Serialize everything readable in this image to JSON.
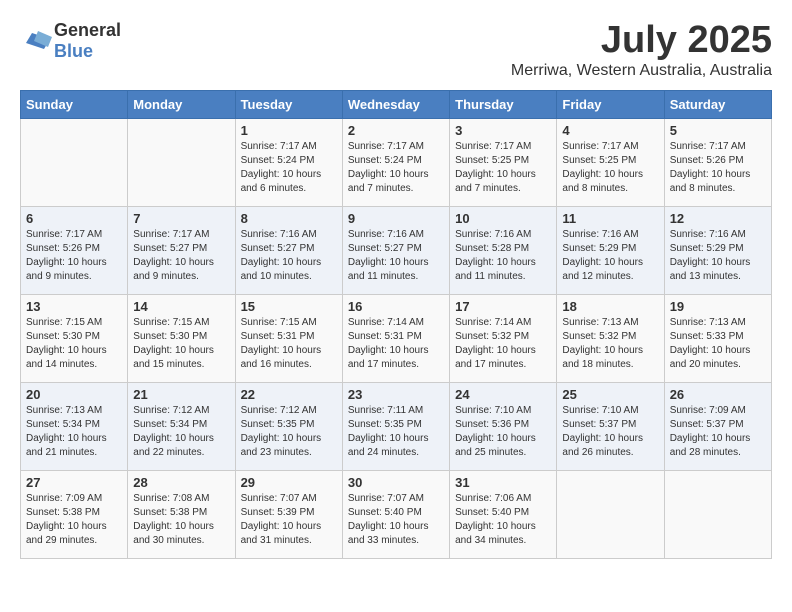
{
  "header": {
    "logo_general": "General",
    "logo_blue": "Blue",
    "month_year": "July 2025",
    "location": "Merriwa, Western Australia, Australia"
  },
  "weekdays": [
    "Sunday",
    "Monday",
    "Tuesday",
    "Wednesday",
    "Thursday",
    "Friday",
    "Saturday"
  ],
  "weeks": [
    [
      {
        "day": "",
        "sunrise": "",
        "sunset": "",
        "daylight": ""
      },
      {
        "day": "",
        "sunrise": "",
        "sunset": "",
        "daylight": ""
      },
      {
        "day": "1",
        "sunrise": "Sunrise: 7:17 AM",
        "sunset": "Sunset: 5:24 PM",
        "daylight": "Daylight: 10 hours and 6 minutes."
      },
      {
        "day": "2",
        "sunrise": "Sunrise: 7:17 AM",
        "sunset": "Sunset: 5:24 PM",
        "daylight": "Daylight: 10 hours and 7 minutes."
      },
      {
        "day": "3",
        "sunrise": "Sunrise: 7:17 AM",
        "sunset": "Sunset: 5:25 PM",
        "daylight": "Daylight: 10 hours and 7 minutes."
      },
      {
        "day": "4",
        "sunrise": "Sunrise: 7:17 AM",
        "sunset": "Sunset: 5:25 PM",
        "daylight": "Daylight: 10 hours and 8 minutes."
      },
      {
        "day": "5",
        "sunrise": "Sunrise: 7:17 AM",
        "sunset": "Sunset: 5:26 PM",
        "daylight": "Daylight: 10 hours and 8 minutes."
      }
    ],
    [
      {
        "day": "6",
        "sunrise": "Sunrise: 7:17 AM",
        "sunset": "Sunset: 5:26 PM",
        "daylight": "Daylight: 10 hours and 9 minutes."
      },
      {
        "day": "7",
        "sunrise": "Sunrise: 7:17 AM",
        "sunset": "Sunset: 5:27 PM",
        "daylight": "Daylight: 10 hours and 9 minutes."
      },
      {
        "day": "8",
        "sunrise": "Sunrise: 7:16 AM",
        "sunset": "Sunset: 5:27 PM",
        "daylight": "Daylight: 10 hours and 10 minutes."
      },
      {
        "day": "9",
        "sunrise": "Sunrise: 7:16 AM",
        "sunset": "Sunset: 5:27 PM",
        "daylight": "Daylight: 10 hours and 11 minutes."
      },
      {
        "day": "10",
        "sunrise": "Sunrise: 7:16 AM",
        "sunset": "Sunset: 5:28 PM",
        "daylight": "Daylight: 10 hours and 11 minutes."
      },
      {
        "day": "11",
        "sunrise": "Sunrise: 7:16 AM",
        "sunset": "Sunset: 5:29 PM",
        "daylight": "Daylight: 10 hours and 12 minutes."
      },
      {
        "day": "12",
        "sunrise": "Sunrise: 7:16 AM",
        "sunset": "Sunset: 5:29 PM",
        "daylight": "Daylight: 10 hours and 13 minutes."
      }
    ],
    [
      {
        "day": "13",
        "sunrise": "Sunrise: 7:15 AM",
        "sunset": "Sunset: 5:30 PM",
        "daylight": "Daylight: 10 hours and 14 minutes."
      },
      {
        "day": "14",
        "sunrise": "Sunrise: 7:15 AM",
        "sunset": "Sunset: 5:30 PM",
        "daylight": "Daylight: 10 hours and 15 minutes."
      },
      {
        "day": "15",
        "sunrise": "Sunrise: 7:15 AM",
        "sunset": "Sunset: 5:31 PM",
        "daylight": "Daylight: 10 hours and 16 minutes."
      },
      {
        "day": "16",
        "sunrise": "Sunrise: 7:14 AM",
        "sunset": "Sunset: 5:31 PM",
        "daylight": "Daylight: 10 hours and 17 minutes."
      },
      {
        "day": "17",
        "sunrise": "Sunrise: 7:14 AM",
        "sunset": "Sunset: 5:32 PM",
        "daylight": "Daylight: 10 hours and 17 minutes."
      },
      {
        "day": "18",
        "sunrise": "Sunrise: 7:13 AM",
        "sunset": "Sunset: 5:32 PM",
        "daylight": "Daylight: 10 hours and 18 minutes."
      },
      {
        "day": "19",
        "sunrise": "Sunrise: 7:13 AM",
        "sunset": "Sunset: 5:33 PM",
        "daylight": "Daylight: 10 hours and 20 minutes."
      }
    ],
    [
      {
        "day": "20",
        "sunrise": "Sunrise: 7:13 AM",
        "sunset": "Sunset: 5:34 PM",
        "daylight": "Daylight: 10 hours and 21 minutes."
      },
      {
        "day": "21",
        "sunrise": "Sunrise: 7:12 AM",
        "sunset": "Sunset: 5:34 PM",
        "daylight": "Daylight: 10 hours and 22 minutes."
      },
      {
        "day": "22",
        "sunrise": "Sunrise: 7:12 AM",
        "sunset": "Sunset: 5:35 PM",
        "daylight": "Daylight: 10 hours and 23 minutes."
      },
      {
        "day": "23",
        "sunrise": "Sunrise: 7:11 AM",
        "sunset": "Sunset: 5:35 PM",
        "daylight": "Daylight: 10 hours and 24 minutes."
      },
      {
        "day": "24",
        "sunrise": "Sunrise: 7:10 AM",
        "sunset": "Sunset: 5:36 PM",
        "daylight": "Daylight: 10 hours and 25 minutes."
      },
      {
        "day": "25",
        "sunrise": "Sunrise: 7:10 AM",
        "sunset": "Sunset: 5:37 PM",
        "daylight": "Daylight: 10 hours and 26 minutes."
      },
      {
        "day": "26",
        "sunrise": "Sunrise: 7:09 AM",
        "sunset": "Sunset: 5:37 PM",
        "daylight": "Daylight: 10 hours and 28 minutes."
      }
    ],
    [
      {
        "day": "27",
        "sunrise": "Sunrise: 7:09 AM",
        "sunset": "Sunset: 5:38 PM",
        "daylight": "Daylight: 10 hours and 29 minutes."
      },
      {
        "day": "28",
        "sunrise": "Sunrise: 7:08 AM",
        "sunset": "Sunset: 5:38 PM",
        "daylight": "Daylight: 10 hours and 30 minutes."
      },
      {
        "day": "29",
        "sunrise": "Sunrise: 7:07 AM",
        "sunset": "Sunset: 5:39 PM",
        "daylight": "Daylight: 10 hours and 31 minutes."
      },
      {
        "day": "30",
        "sunrise": "Sunrise: 7:07 AM",
        "sunset": "Sunset: 5:40 PM",
        "daylight": "Daylight: 10 hours and 33 minutes."
      },
      {
        "day": "31",
        "sunrise": "Sunrise: 7:06 AM",
        "sunset": "Sunset: 5:40 PM",
        "daylight": "Daylight: 10 hours and 34 minutes."
      },
      {
        "day": "",
        "sunrise": "",
        "sunset": "",
        "daylight": ""
      },
      {
        "day": "",
        "sunrise": "",
        "sunset": "",
        "daylight": ""
      }
    ]
  ]
}
